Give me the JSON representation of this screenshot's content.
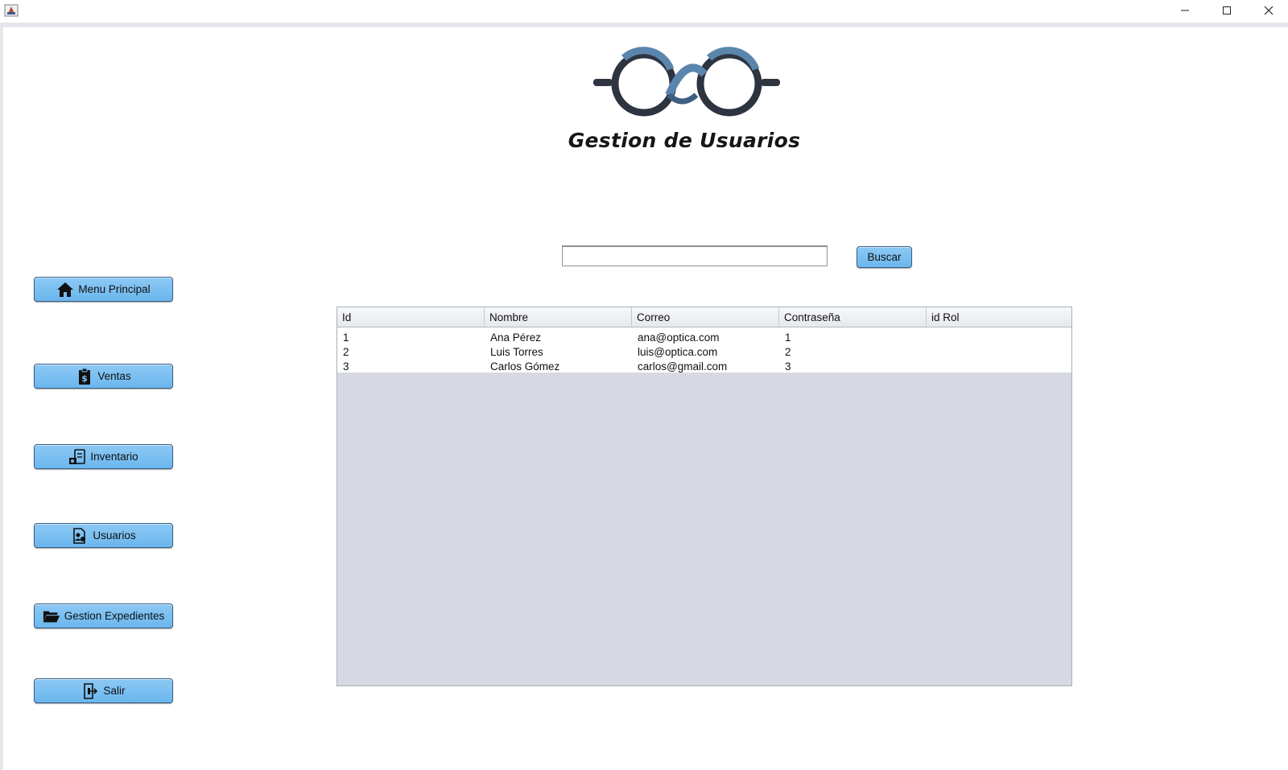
{
  "window": {
    "app_icon": "java-icon",
    "controls": [
      "minimize-icon",
      "maximize-icon",
      "close-icon"
    ]
  },
  "header": {
    "title": "Gestion de Usuarios",
    "logo": "glasses-logo"
  },
  "search": {
    "value": "",
    "button_label": "Buscar"
  },
  "sidebar": {
    "items": [
      {
        "label": "Menu Principal",
        "icon": "home-icon"
      },
      {
        "label": "Ventas",
        "icon": "sales-clipboard-icon"
      },
      {
        "label": "Inventario",
        "icon": "inventory-icon"
      },
      {
        "label": "Usuarios",
        "icon": "users-document-icon"
      },
      {
        "label": "Gestion Expedientes",
        "icon": "folder-open-icon"
      },
      {
        "label": "Salir",
        "icon": "exit-icon"
      }
    ]
  },
  "table": {
    "columns": [
      "Id",
      "Nombre",
      "Correo",
      "Contraseña",
      "id Rol"
    ],
    "rows": [
      [
        "1",
        "Ana Pérez",
        "ana@optica.com",
        "1",
        ""
      ],
      [
        "2",
        "Luis Torres",
        "luis@optica.com",
        "2",
        ""
      ],
      [
        "3",
        "Carlos Gómez",
        "carlos@gmail.com",
        "3",
        ""
      ]
    ]
  },
  "colors": {
    "button": "#7cc0f2",
    "table_empty": "#d6d9e1",
    "logo_dark": "#2e3440",
    "logo_blue": "#5a86ad"
  }
}
